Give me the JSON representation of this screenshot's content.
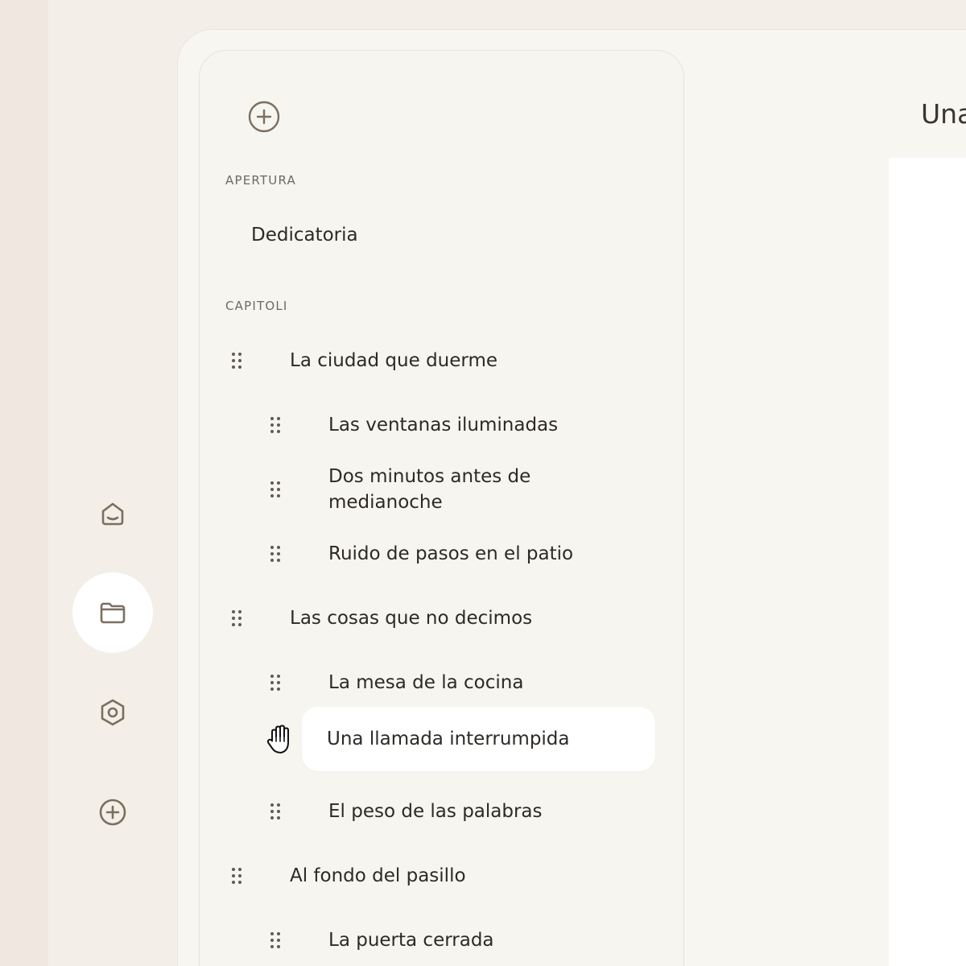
{
  "rail": {
    "items": [
      {
        "icon": "home-icon",
        "active": false
      },
      {
        "icon": "folder-icon",
        "active": true
      },
      {
        "icon": "settings-icon",
        "active": false
      },
      {
        "icon": "add-icon",
        "active": false
      }
    ]
  },
  "sidebar": {
    "add_icon": "add-circle-icon",
    "front_label": "APERTURA",
    "front_items": [
      {
        "label": "Dedicatoria"
      }
    ],
    "chapters_label": "CAPITOLI",
    "chapters": [
      {
        "label": "La ciudad que duerme",
        "level": 0
      },
      {
        "label": "Las ventanas iluminadas",
        "level": 1
      },
      {
        "label": "Dos minutos antes de medianoche",
        "level": 1
      },
      {
        "label": "Ruido de pasos en el patio",
        "level": 1
      },
      {
        "label": "Las cosas que no decimos",
        "level": 0
      },
      {
        "label": "La mesa de la cocina",
        "level": 1
      },
      {
        "label": "Una llamada interrumpida",
        "level": 1,
        "selected": true,
        "dragging": true
      },
      {
        "label": "El peso de las palabras",
        "level": 1
      },
      {
        "label": "Al fondo del pasillo",
        "level": 0
      },
      {
        "label": "La puerta cerrada",
        "level": 1
      }
    ]
  },
  "document": {
    "title": "Una"
  },
  "colors": {
    "background": "#f3eee7",
    "panel": "#f7f5f0",
    "selected": "#ffffff",
    "icon": "#7a6f5f",
    "text": "#2d2a26"
  }
}
